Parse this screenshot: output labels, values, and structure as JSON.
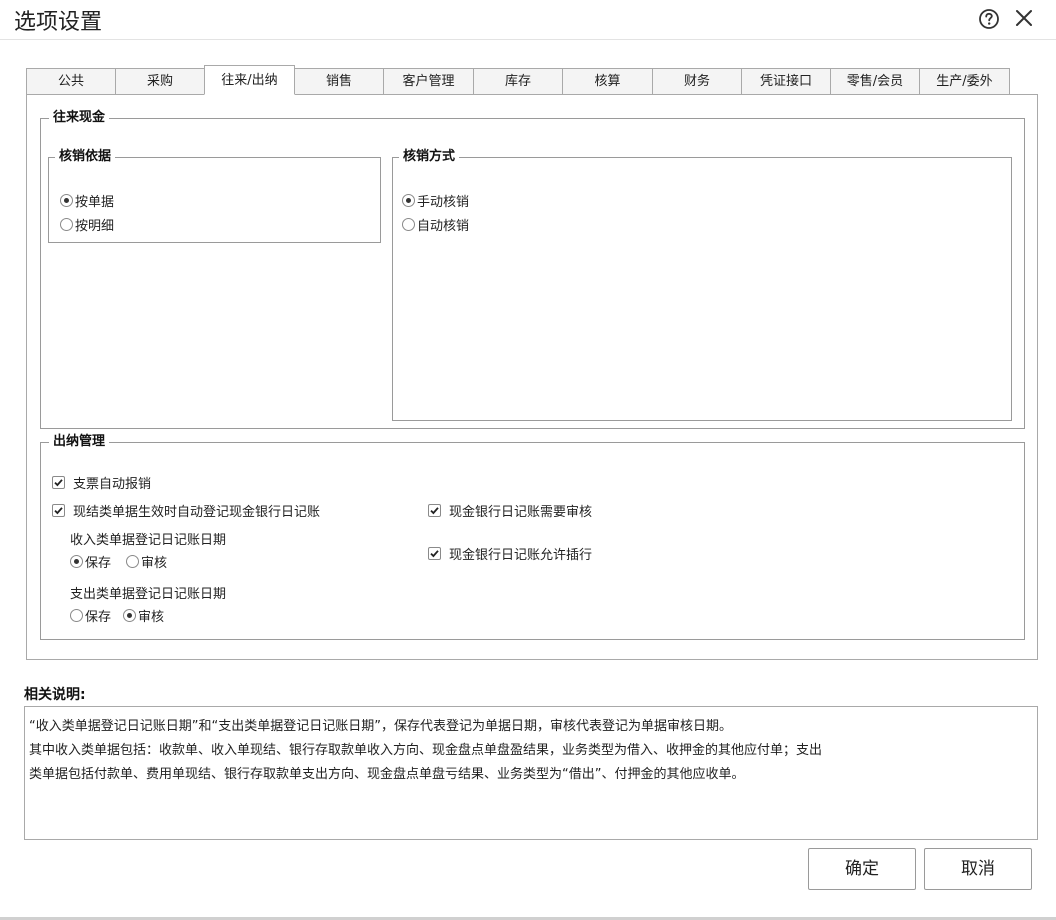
{
  "window": {
    "title": "选项设置"
  },
  "tabs": [
    {
      "label": "公共",
      "active": false
    },
    {
      "label": "采购",
      "active": false
    },
    {
      "label": "往来/出纳",
      "active": true
    },
    {
      "label": "销售",
      "active": false
    },
    {
      "label": "客户管理",
      "active": false
    },
    {
      "label": "库存",
      "active": false
    },
    {
      "label": "核算",
      "active": false
    },
    {
      "label": "财务",
      "active": false
    },
    {
      "label": "凭证接口",
      "active": false
    },
    {
      "label": "零售/会员",
      "active": false
    },
    {
      "label": "生产/委外",
      "active": false
    }
  ],
  "wanglai": {
    "title": "往来现金",
    "basis": {
      "title": "核销依据",
      "options": [
        {
          "label": "按单据",
          "selected": true
        },
        {
          "label": "按明细",
          "selected": false
        }
      ]
    },
    "method": {
      "title": "核销方式",
      "options": [
        {
          "label": "手动核销",
          "selected": true
        },
        {
          "label": "自动核销",
          "selected": false
        }
      ]
    }
  },
  "chuna": {
    "title": "出纳管理",
    "cheque_auto": {
      "label": "支票自动报销",
      "checked": true
    },
    "auto_register": {
      "label": "现结类单据生效时自动登记现金银行日记账",
      "checked": true
    },
    "need_audit": {
      "label": "现金银行日记账需要审核",
      "checked": true
    },
    "allow_insert": {
      "label": "现金银行日记账允许插行",
      "checked": true
    },
    "income_date": {
      "label": "收入类单据登记日记账日期",
      "options": [
        {
          "label": "保存",
          "selected": true
        },
        {
          "label": "审核",
          "selected": false
        }
      ]
    },
    "expense_date": {
      "label": "支出类单据登记日记账日期",
      "options": [
        {
          "label": "保存",
          "selected": false
        },
        {
          "label": "审核",
          "selected": true
        }
      ]
    }
  },
  "description": {
    "title": "相关说明:",
    "lines": [
      "“收入类单据登记日记账日期”和“支出类单据登记日记账日期”，保存代表登记为单据日期，审核代表登记为单据审核日期。",
      "其中收入类单据包括：收款单、收入单现结、银行存取款单收入方向、现金盘点单盘盈结果，业务类型为借入、收押金的其他应付单；支出",
      "类单据包括付款单、费用单现结、银行存取款单支出方向、现金盘点单盘亏结果、业务类型为“借出”、付押金的其他应收单。"
    ]
  },
  "buttons": {
    "ok": "确定",
    "cancel": "取消"
  }
}
